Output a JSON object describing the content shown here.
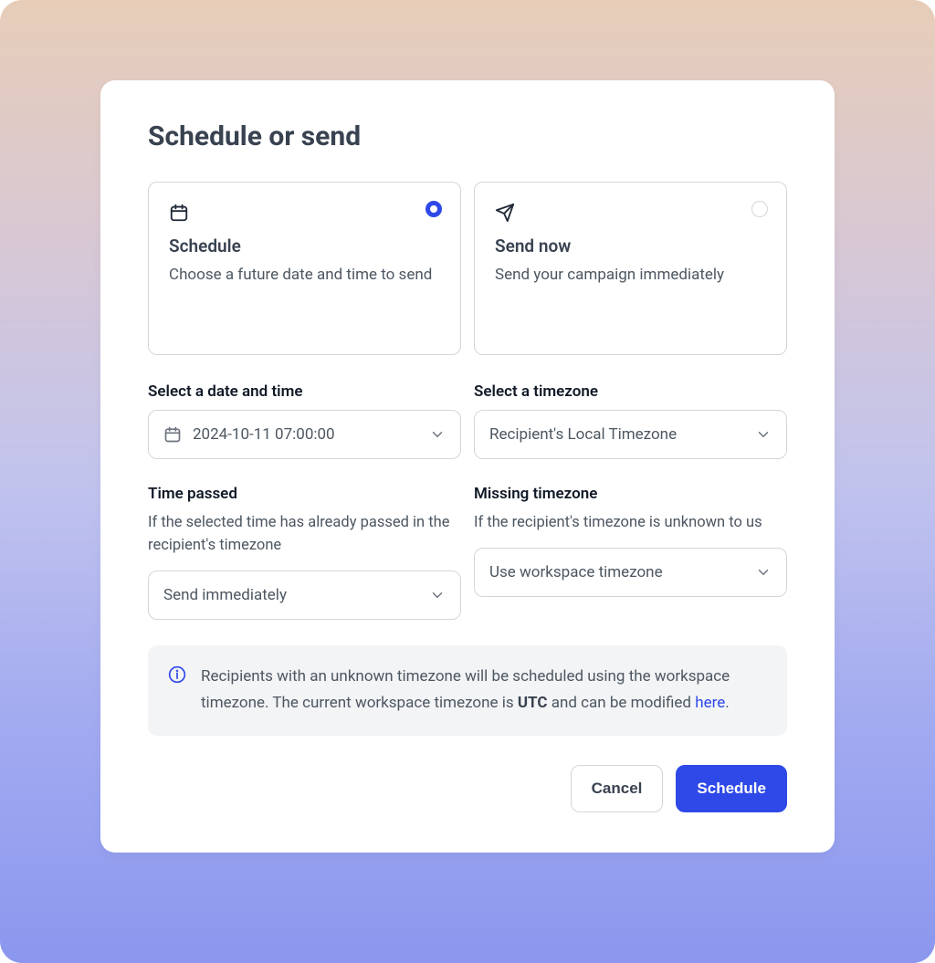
{
  "title": "Schedule or send",
  "options": {
    "schedule": {
      "title": "Schedule",
      "desc": "Choose a future date and time to send",
      "selected": true
    },
    "send_now": {
      "title": "Send now",
      "desc": "Send your campaign immediately",
      "selected": false
    }
  },
  "datetime": {
    "label": "Select a date and time",
    "value": "2024-10-11 07:00:00"
  },
  "timezone": {
    "label": "Select a timezone",
    "value": "Recipient's Local Timezone"
  },
  "time_passed": {
    "label": "Time passed",
    "sublabel": "If the selected time has already passed in the recipient's timezone",
    "value": "Send immediately"
  },
  "missing_timezone": {
    "label": "Missing timezone",
    "sublabel": "If the recipient's timezone is unknown to us",
    "value": "Use workspace timezone"
  },
  "banner": {
    "text_before": "Recipients with an unknown timezone will be scheduled using the workspace timezone. The current workspace timezone is ",
    "tz": "UTC",
    "text_after_tz": " and can be modified ",
    "link": "here",
    "period": "."
  },
  "actions": {
    "cancel": "Cancel",
    "schedule": "Schedule"
  }
}
